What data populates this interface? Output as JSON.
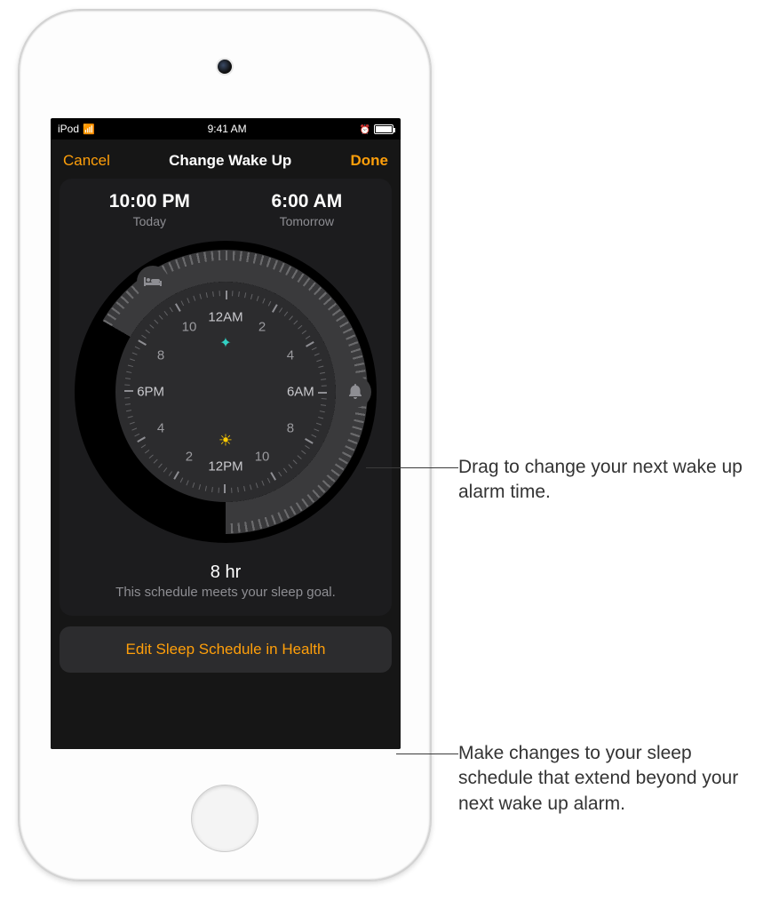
{
  "status": {
    "device": "iPod",
    "time": "9:41 AM"
  },
  "nav": {
    "cancel": "Cancel",
    "title": "Change Wake Up",
    "done": "Done"
  },
  "times": {
    "bed": {
      "time": "10:00 PM",
      "day": "Today"
    },
    "wake": {
      "time": "6:00 AM",
      "day": "Tomorrow"
    }
  },
  "clock": {
    "labels": {
      "n": "12AM",
      "s": "12PM",
      "e": "6AM",
      "w": "6PM",
      "h2": "2",
      "h4": "4",
      "h8l": "8",
      "h10l": "10",
      "h2b": "2",
      "h4b": "4",
      "h8r": "8",
      "h10r": "10"
    }
  },
  "goal": {
    "hours": "8 hr",
    "message": "This schedule meets your sleep goal."
  },
  "edit_link": "Edit Sleep Schedule in Health",
  "callouts": {
    "c1": "Drag to change your next wake up alarm time.",
    "c2": "Make changes to your sleep schedule that extend beyond your next wake up alarm."
  },
  "icons": {
    "bed": "bed-icon",
    "bell": "bell-icon",
    "sparkle": "sparkle-icon",
    "sun": "sun-icon"
  }
}
